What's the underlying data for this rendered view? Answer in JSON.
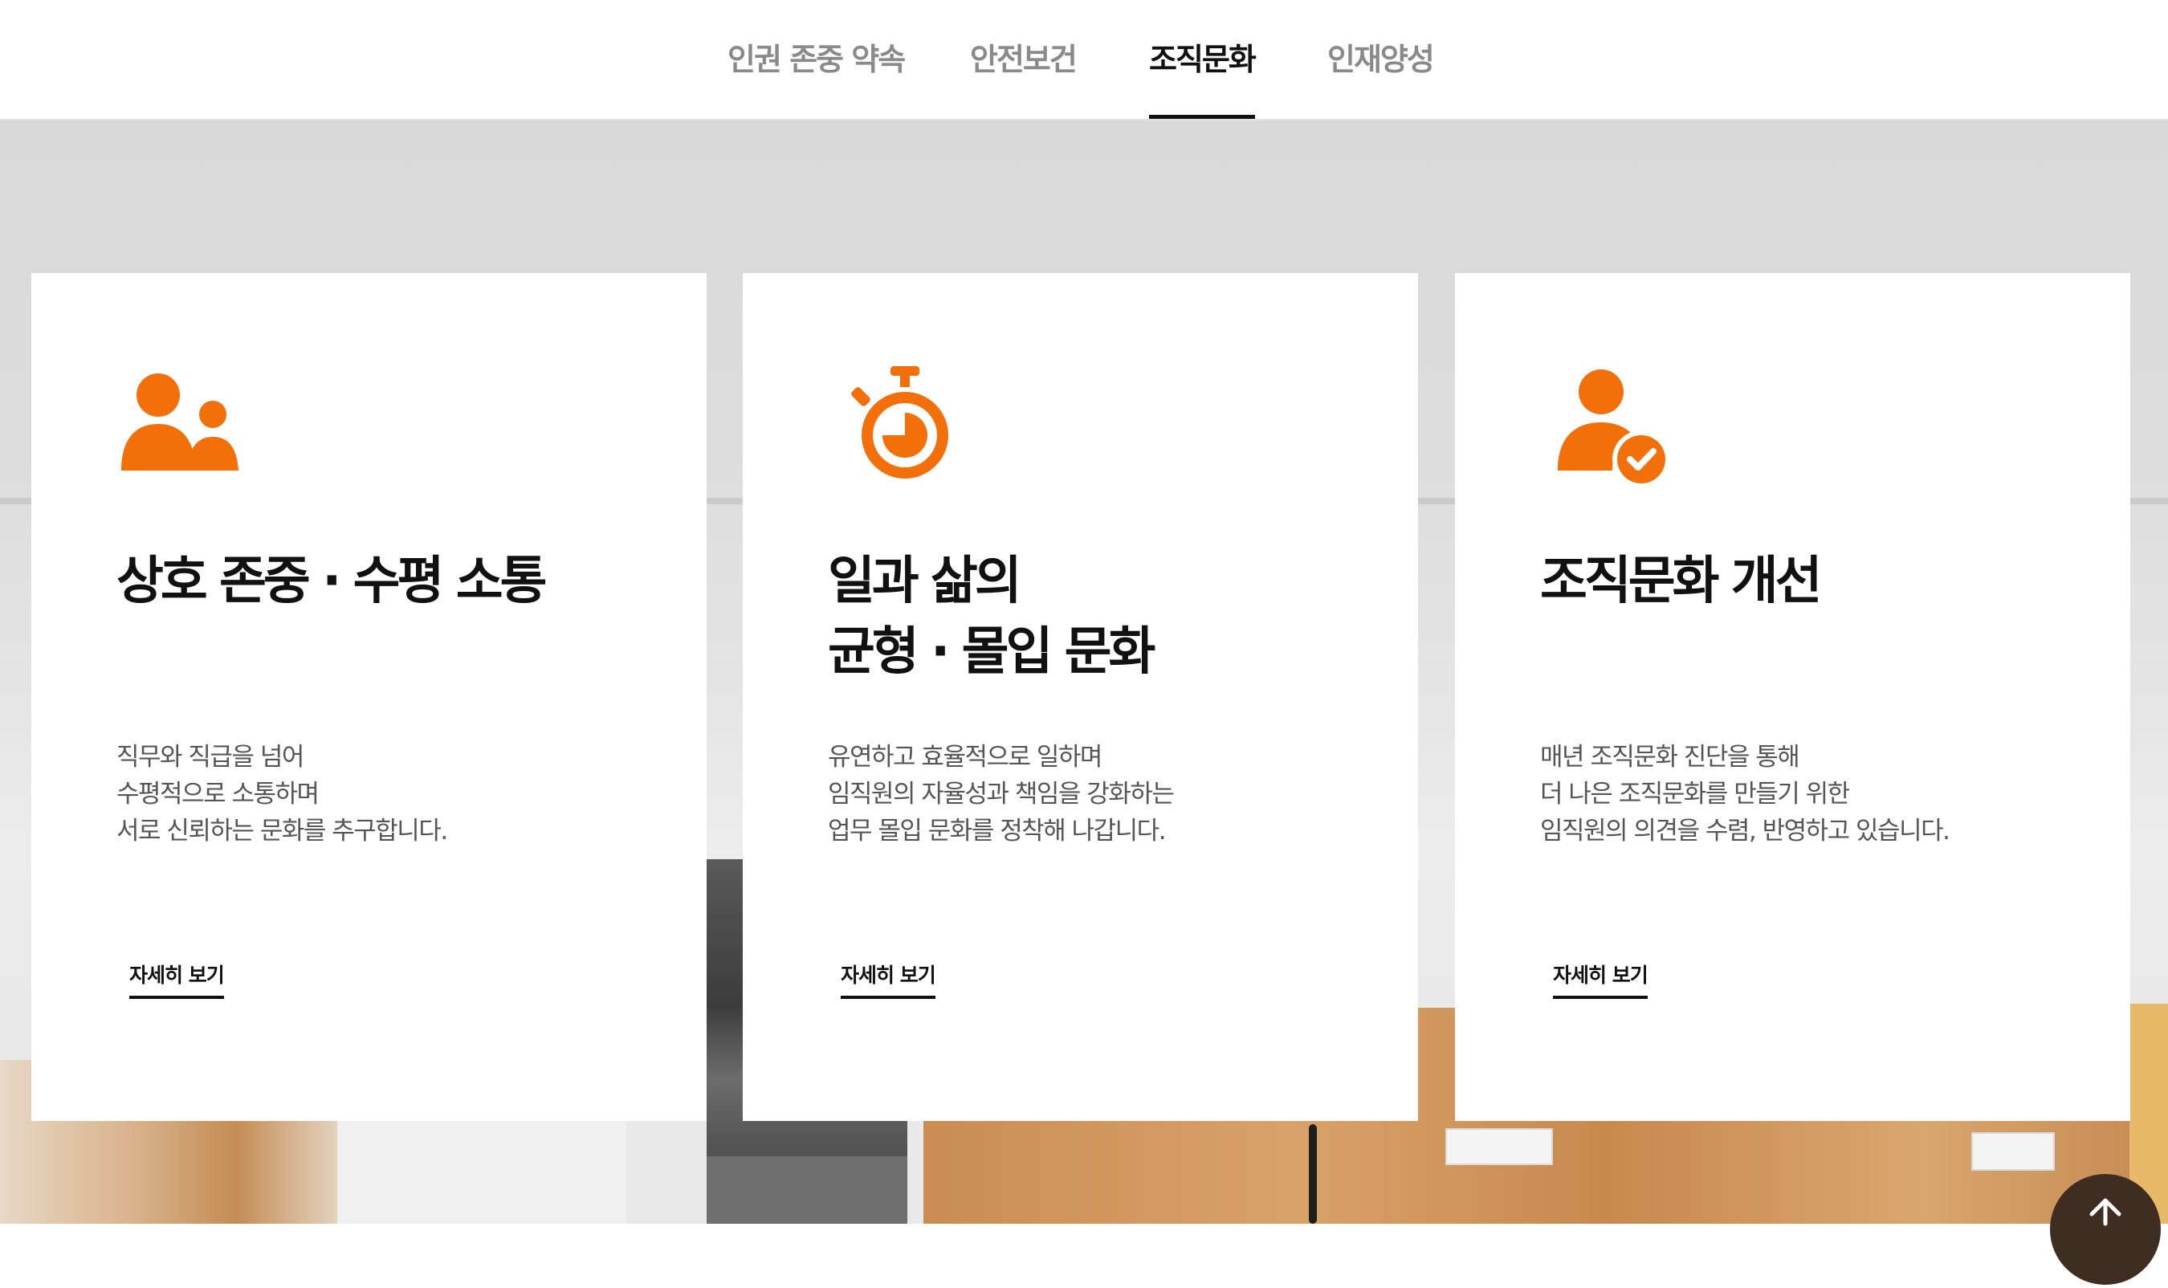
{
  "tabs": [
    {
      "label": "인권 존중 약속",
      "active": false
    },
    {
      "label": "안전보건",
      "active": false
    },
    {
      "label": "조직문화",
      "active": true
    },
    {
      "label": "인재양성",
      "active": false
    }
  ],
  "accent_color": "#f36f0a",
  "cards": [
    {
      "icon": "people-icon",
      "title_lines": [
        "상호 존중 · 수평 소통"
      ],
      "desc_lines": [
        "직무와 직급을 넘어",
        "수평적으로 소통하며",
        "서로 신뢰하는 문화를 추구합니다."
      ],
      "more_label": "자세히 보기"
    },
    {
      "icon": "stopwatch-icon",
      "title_lines": [
        "일과 삶의",
        "균형 · 몰입 문화"
      ],
      "desc_lines": [
        "유연하고 효율적으로 일하며",
        "임직원의 자율성과 책임을 강화하는",
        "업무 몰입 문화를 정착해 나갑니다."
      ],
      "more_label": "자세히 보기"
    },
    {
      "icon": "user-check-icon",
      "title_lines": [
        "조직문화 개선"
      ],
      "desc_lines": [
        "매년 조직문화 진단을 통해",
        "더 나은 조직문화를 만들기 위한",
        "임직원의 의견을 수렴, 반영하고 있습니다."
      ],
      "more_label": "자세히 보기"
    }
  ],
  "scroll_top_icon": "arrow-up-icon"
}
